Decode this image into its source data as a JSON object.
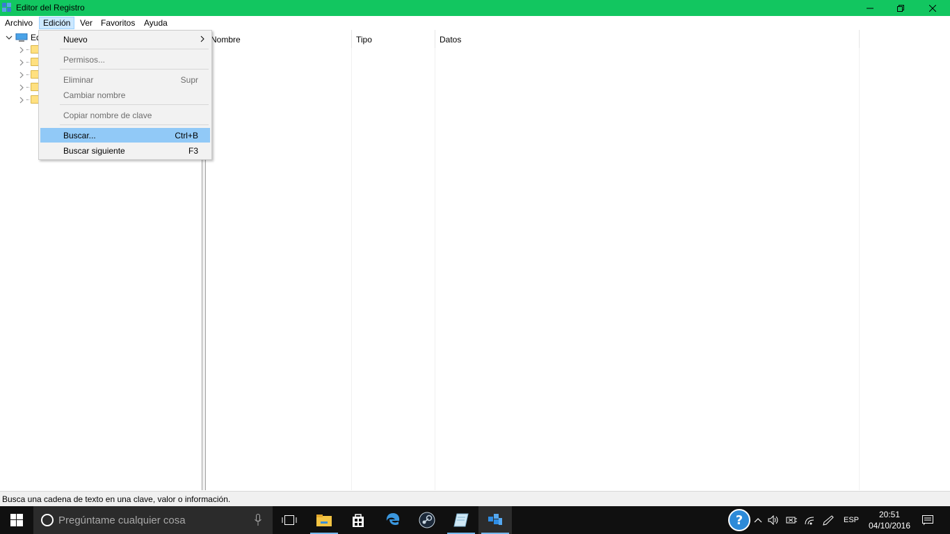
{
  "window": {
    "title": "Editor del Registro"
  },
  "menubar": {
    "items": [
      "Archivo",
      "Edición",
      "Ver",
      "Favoritos",
      "Ayuda"
    ],
    "active": "Edición"
  },
  "tree": {
    "root_label": "Eq"
  },
  "values": {
    "columns": [
      "Nombre",
      "Tipo",
      "Datos"
    ]
  },
  "edit_menu": {
    "nuevo": "Nuevo",
    "permisos": "Permisos...",
    "eliminar": "Eliminar",
    "eliminar_shortcut": "Supr",
    "cambiar_nombre": "Cambiar nombre",
    "copiar_nombre": "Copiar nombre de clave",
    "buscar": "Buscar...",
    "buscar_shortcut": "Ctrl+B",
    "buscar_siguiente": "Buscar siguiente",
    "buscar_siguiente_shortcut": "F3"
  },
  "statusbar": {
    "text": "Busca una cadena de texto en una clave, valor o información."
  },
  "taskbar": {
    "search_placeholder": "Pregúntame cualquier cosa",
    "language": "ESP",
    "time": "20:51",
    "date": "04/10/2016",
    "apps": [
      "task-view-icon",
      "file-explorer-icon",
      "store-icon",
      "edge-icon",
      "steam-icon",
      "notes-icon",
      "regedit-icon"
    ]
  },
  "colors": {
    "titlebar": "#12c660",
    "menu_highlight": "#91c9f7",
    "taskbar": "#101010"
  }
}
